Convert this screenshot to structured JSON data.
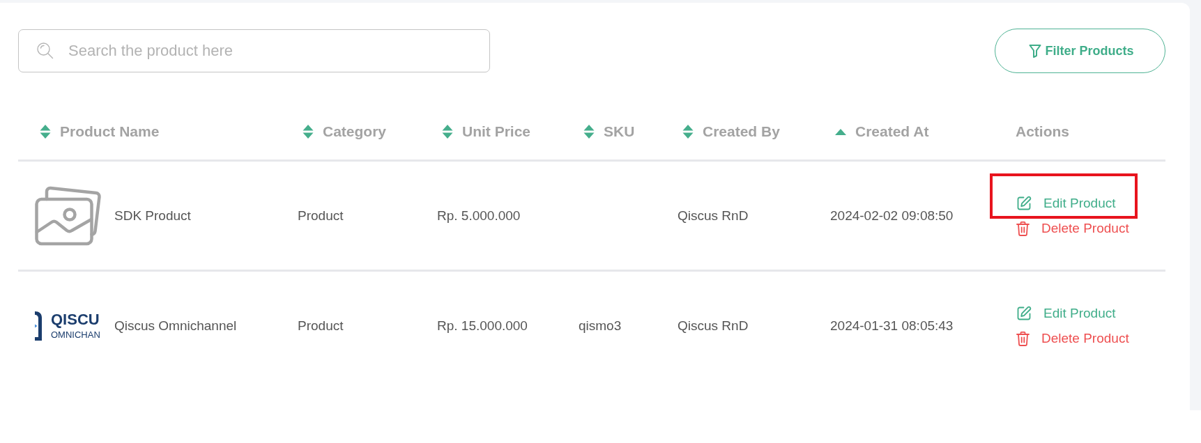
{
  "toolbar": {
    "search": {
      "placeholder": "Search the product here"
    },
    "filter_button": {
      "label": "Filter Products"
    }
  },
  "table": {
    "columns": [
      {
        "label": "Product Name",
        "sortable": true,
        "sorted": false
      },
      {
        "label": "Category",
        "sortable": true,
        "sorted": false
      },
      {
        "label": "Unit Price",
        "sortable": true,
        "sorted": false
      },
      {
        "label": "SKU",
        "sortable": true,
        "sorted": false
      },
      {
        "label": "Created By",
        "sortable": true,
        "sorted": false
      },
      {
        "label": "Created At",
        "sortable": true,
        "sorted": true
      },
      {
        "label": "Actions",
        "sortable": false,
        "sorted": false
      }
    ],
    "rows": [
      {
        "image": {
          "kind": "placeholder"
        },
        "product_name": "SDK Product",
        "category": "Product",
        "unit_price": "Rp. 5.000.000",
        "created_by": "Qiscus RnD",
        "created_at": "2024-02-02 09:08:50",
        "actions": [
          {
            "kind": "edit",
            "label": "Edit Product",
            "highlighted": true
          },
          {
            "kind": "delete",
            "label": "Delete Product",
            "highlighted": false
          }
        ]
      },
      {
        "image": {
          "kind": "logo",
          "lines": [
            "QISCU",
            "OMNICHAN"
          ]
        },
        "product_name": "Qiscus Omnichannel",
        "category": "Product",
        "unit_price": "Rp. 15.000.000",
        "sku": "qismo3",
        "created_by": "Qiscus RnD",
        "created_at": "2024-01-31 08:05:43",
        "actions": [
          {
            "kind": "edit",
            "label": "Edit Product",
            "highlighted": false
          },
          {
            "kind": "delete",
            "label": "Delete Product",
            "highlighted": false
          }
        ]
      }
    ]
  }
}
